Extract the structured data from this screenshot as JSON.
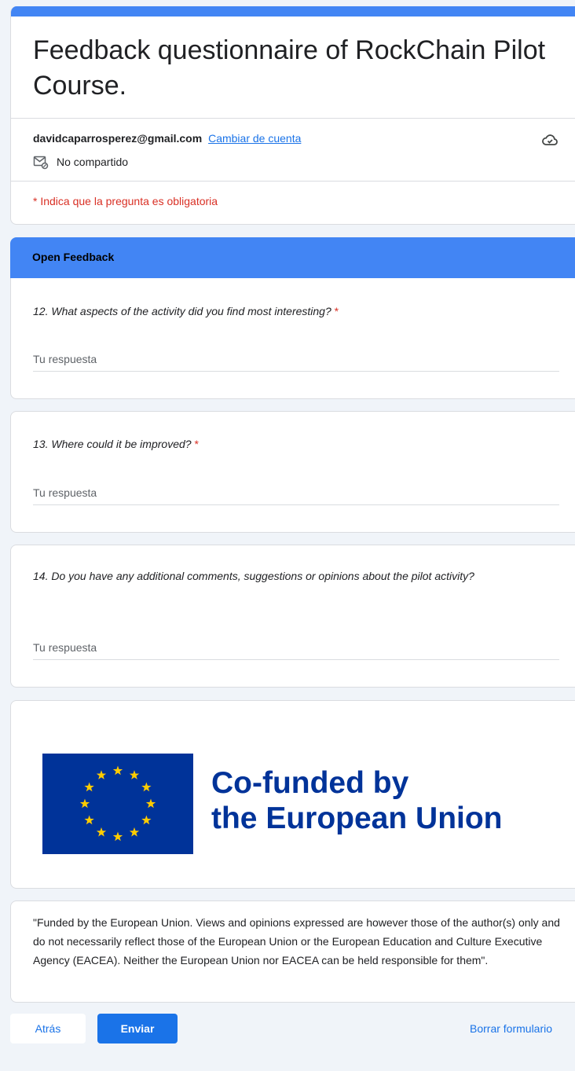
{
  "header": {
    "title": "Feedback questionnaire of RockChain Pilot Course.",
    "account_email": "davidcaparrosperez@gmail.com",
    "switch_account_label": "Cambiar de cuenta",
    "not_shared_label": "No compartido",
    "required_note": "* Indica que la pregunta es obligatoria",
    "cloud_icon": "cloud-saved-icon",
    "not_shared_icon": "email-not-shared-icon"
  },
  "section": {
    "title": "Open Feedback"
  },
  "questions": [
    {
      "text": "12. What aspects of the activity did you find most interesting?",
      "required_marker": "*",
      "placeholder": "Tu respuesta",
      "value": ""
    },
    {
      "text": "13. Where could it be improved?",
      "required_marker": "*",
      "placeholder": "Tu respuesta",
      "value": ""
    },
    {
      "text": "14. Do you have any additional comments, suggestions or opinions about the pilot activity?",
      "placeholder": "Tu respuesta",
      "value": ""
    }
  ],
  "logo": {
    "line1": "Co-funded by",
    "line2": "the European Union"
  },
  "disclaimer": "\"Funded by the European Union. Views and opinions expressed are however those of the author(s) only and do not necessarily reflect those of the European Union or the European Education and Culture Executive Agency (EACEA). Neither the European Union nor EACEA can be held responsible for them\".",
  "actions": {
    "back_label": "Atrás",
    "submit_label": "Enviar",
    "clear_label": "Borrar formulario"
  },
  "colors": {
    "accent": "#4285f4",
    "primary_button": "#1a73e8",
    "required": "#d93025",
    "eu_blue": "#003399",
    "eu_star": "#ffcc00"
  }
}
